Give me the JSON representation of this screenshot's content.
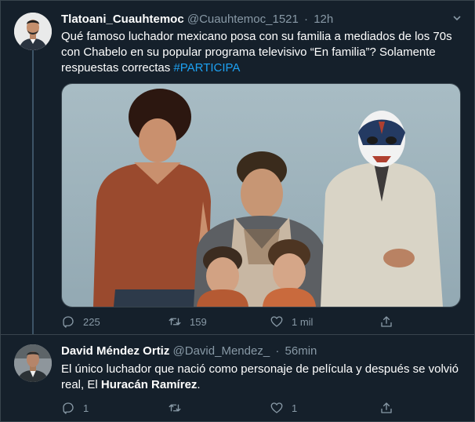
{
  "tweets": [
    {
      "author_name": "Tlatoani_Cuauhtemoc",
      "handle": "@Cuauhtemoc_1521",
      "separator": "·",
      "time": "12h",
      "text_main": "Qué famoso luchador mexicano posa con su familia a mediados de los 70s con Chabelo en su popular programa televisivo “En familia”? Solamente respuestas correctas ",
      "hashtag": "#PARTICIPA",
      "counts": {
        "replies": "225",
        "retweets": "159",
        "likes": "1 mil"
      }
    },
    {
      "author_name": "David Méndez Ortiz",
      "handle": "@David_Mendez_",
      "separator": "·",
      "time": "56min",
      "text_main": "El único luchador que nació como personaje de película y después se volvió real, El ",
      "text_bold": "Huracán Ramírez",
      "text_end": ".",
      "counts": {
        "replies": "1",
        "retweets": "",
        "likes": "1"
      }
    }
  ],
  "colors": {
    "background": "#15202b",
    "border": "#38444d",
    "muted_text": "#8899a6",
    "link": "#1da1f2"
  },
  "icons": [
    "reply-icon",
    "retweet-icon",
    "like-icon",
    "share-icon",
    "chevron-down-icon"
  ]
}
